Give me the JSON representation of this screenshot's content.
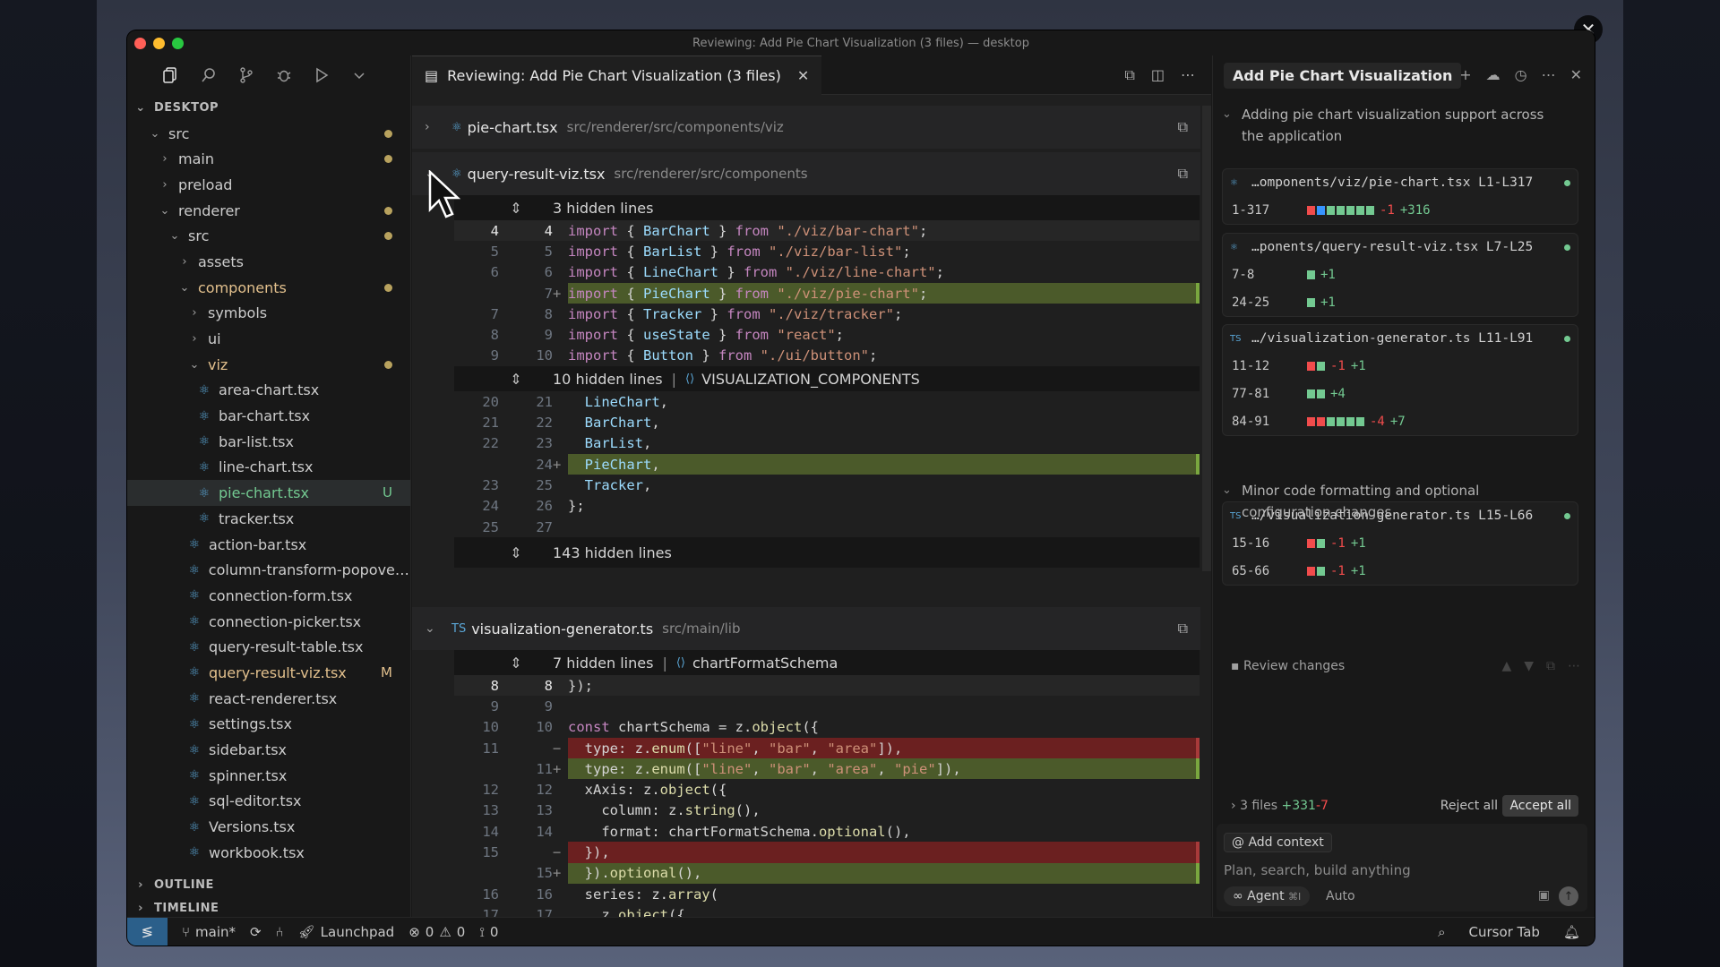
{
  "window": {
    "title": "Reviewing: Add Pie Chart Visualization (3 files) — desktop",
    "traffic_colors": [
      "#ff5f57",
      "#febc2e",
      "#28c840"
    ],
    "overlay_close_icon": "close-icon"
  },
  "activity_bar": {
    "icons": [
      "files-icon",
      "search-icon",
      "source-control-icon",
      "debug-icon",
      "run-icon",
      "chevron-down-icon"
    ]
  },
  "explorer": {
    "root": "DESKTOP",
    "items": [
      {
        "label": "src",
        "depth": 0,
        "kind": "folder-open",
        "status": "dot"
      },
      {
        "label": "main",
        "depth": 1,
        "kind": "folder",
        "status": "dot"
      },
      {
        "label": "preload",
        "depth": 1,
        "kind": "folder",
        "status": ""
      },
      {
        "label": "renderer",
        "depth": 1,
        "kind": "folder-open",
        "status": "dot"
      },
      {
        "label": "src",
        "depth": 2,
        "kind": "folder-open",
        "status": "dot"
      },
      {
        "label": "assets",
        "depth": 3,
        "kind": "folder",
        "status": ""
      },
      {
        "label": "components",
        "depth": 3,
        "kind": "folder-open",
        "status": "dot",
        "modified": true
      },
      {
        "label": "symbols",
        "depth": 4,
        "kind": "folder",
        "status": ""
      },
      {
        "label": "ui",
        "depth": 4,
        "kind": "folder",
        "status": ""
      },
      {
        "label": "viz",
        "depth": 4,
        "kind": "folder-open",
        "status": "dot",
        "modified": true
      },
      {
        "label": "area-chart.tsx",
        "depth": 5,
        "kind": "file",
        "status": ""
      },
      {
        "label": "bar-chart.tsx",
        "depth": 5,
        "kind": "file",
        "status": ""
      },
      {
        "label": "bar-list.tsx",
        "depth": 5,
        "kind": "file",
        "status": ""
      },
      {
        "label": "line-chart.tsx",
        "depth": 5,
        "kind": "file",
        "status": ""
      },
      {
        "label": "pie-chart.tsx",
        "depth": 5,
        "kind": "file",
        "status": "U",
        "selected": true
      },
      {
        "label": "tracker.tsx",
        "depth": 5,
        "kind": "file",
        "status": ""
      },
      {
        "label": "action-bar.tsx",
        "depth": 4,
        "kind": "file",
        "status": ""
      },
      {
        "label": "column-transform-popover...",
        "depth": 4,
        "kind": "file",
        "status": ""
      },
      {
        "label": "connection-form.tsx",
        "depth": 4,
        "kind": "file",
        "status": ""
      },
      {
        "label": "connection-picker.tsx",
        "depth": 4,
        "kind": "file",
        "status": ""
      },
      {
        "label": "query-result-table.tsx",
        "depth": 4,
        "kind": "file",
        "status": ""
      },
      {
        "label": "query-result-viz.tsx",
        "depth": 4,
        "kind": "file",
        "status": "M"
      },
      {
        "label": "react-renderer.tsx",
        "depth": 4,
        "kind": "file",
        "status": ""
      },
      {
        "label": "settings.tsx",
        "depth": 4,
        "kind": "file",
        "status": ""
      },
      {
        "label": "sidebar.tsx",
        "depth": 4,
        "kind": "file",
        "status": ""
      },
      {
        "label": "spinner.tsx",
        "depth": 4,
        "kind": "file",
        "status": ""
      },
      {
        "label": "sql-editor.tsx",
        "depth": 4,
        "kind": "file",
        "status": ""
      },
      {
        "label": "Versions.tsx",
        "depth": 4,
        "kind": "file",
        "status": ""
      },
      {
        "label": "workbook.tsx",
        "depth": 4,
        "kind": "file",
        "status": ""
      }
    ],
    "outline": "OUTLINE",
    "timeline": "TIMELINE"
  },
  "editor": {
    "tab_label": "Reviewing: Add Pie Chart Visualization (3 files)",
    "files": [
      {
        "type": "⚛",
        "name": "pie-chart.tsx",
        "path": "src/renderer/src/components/viz",
        "chevron": "›"
      },
      {
        "type": "⚛",
        "name": "query-result-viz.tsx",
        "path": "src/renderer/src/components",
        "chevron": "⌄"
      },
      {
        "type": "TS",
        "name": "visualization-generator.ts",
        "path": "src/main/lib",
        "chevron": "⌄"
      }
    ],
    "hidden": {
      "h1": "3 hidden lines",
      "h2": "10 hidden lines",
      "h2_symbol": "VISUALIZATION_COMPONENTS",
      "h3": "143 hidden lines",
      "h4": "7 hidden lines",
      "h4_symbol": "chartFormatSchema",
      "separator": "|"
    },
    "block1": [
      {
        "o": "4",
        "n": "4",
        "m": "",
        "kind": "cur",
        "code": "import { BarChart } from \"./viz/bar-chart\";"
      },
      {
        "o": "5",
        "n": "5",
        "m": "",
        "kind": "",
        "code": "import { BarList } from \"./viz/bar-list\";"
      },
      {
        "o": "6",
        "n": "6",
        "m": "",
        "kind": "",
        "code": "import { LineChart } from \"./viz/line-chart\";"
      },
      {
        "o": "",
        "n": "7",
        "m": "+",
        "kind": "add",
        "code": "import { PieChart } from \"./viz/pie-chart\";"
      },
      {
        "o": "7",
        "n": "8",
        "m": "",
        "kind": "",
        "code": "import { Tracker } from \"./viz/tracker\";"
      },
      {
        "o": "8",
        "n": "9",
        "m": "",
        "kind": "",
        "code": "import { useState } from \"react\";"
      },
      {
        "o": "9",
        "n": "10",
        "m": "",
        "kind": "",
        "code": "import { Button } from \"./ui/button\";"
      }
    ],
    "block2": [
      {
        "o": "20",
        "n": "21",
        "m": "",
        "kind": "",
        "code": "  LineChart,"
      },
      {
        "o": "21",
        "n": "22",
        "m": "",
        "kind": "",
        "code": "  BarChart,"
      },
      {
        "o": "22",
        "n": "23",
        "m": "",
        "kind": "",
        "code": "  BarList,"
      },
      {
        "o": "",
        "n": "24",
        "m": "+",
        "kind": "add",
        "code": "  PieChart,"
      },
      {
        "o": "23",
        "n": "25",
        "m": "",
        "kind": "",
        "code": "  Tracker,"
      },
      {
        "o": "24",
        "n": "26",
        "m": "",
        "kind": "",
        "code": "};"
      },
      {
        "o": "25",
        "n": "27",
        "m": "",
        "kind": "",
        "code": ""
      }
    ],
    "block3": [
      {
        "o": "8",
        "n": "8",
        "m": "",
        "kind": "cur",
        "code": "});"
      },
      {
        "o": "9",
        "n": "9",
        "m": "",
        "kind": "",
        "code": ""
      },
      {
        "o": "10",
        "n": "10",
        "m": "",
        "kind": "",
        "code": "const chartSchema = z.object({"
      },
      {
        "o": "11",
        "n": "",
        "m": "−",
        "kind": "del",
        "code": "  type: z.enum([\"line\", \"bar\", \"area\"]),"
      },
      {
        "o": "",
        "n": "11",
        "m": "+",
        "kind": "add",
        "code": "  type: z.enum([\"line\", \"bar\", \"area\", \"pie\"]),"
      },
      {
        "o": "12",
        "n": "12",
        "m": "",
        "kind": "",
        "code": "  xAxis: z.object({"
      },
      {
        "o": "13",
        "n": "13",
        "m": "",
        "kind": "",
        "code": "    column: z.string(),"
      },
      {
        "o": "14",
        "n": "14",
        "m": "",
        "kind": "",
        "code": "    format: chartFormatSchema.optional(),"
      },
      {
        "o": "15",
        "n": "",
        "m": "−",
        "kind": "del",
        "code": "  }),"
      },
      {
        "o": "",
        "n": "15",
        "m": "+",
        "kind": "add",
        "code": "  }).optional(),"
      },
      {
        "o": "16",
        "n": "16",
        "m": "",
        "kind": "",
        "code": "  series: z.array("
      },
      {
        "o": "17",
        "n": "17",
        "m": "",
        "kind": "",
        "code": "    z.object({"
      },
      {
        "o": "18",
        "n": "18",
        "m": "",
        "kind": "",
        "code": "      column: z.string(),"
      }
    ]
  },
  "chat": {
    "tab_title": "Add Pie Chart Visualization",
    "header_icons": [
      "plus-icon",
      "cloud-icon",
      "history-icon",
      "more-icon",
      "close-icon"
    ],
    "note1": "Adding pie chart visualization support across the application",
    "note2": "Minor code formatting and optional configuration changes",
    "cards": [
      {
        "type": "⚛",
        "file": "…omponents/viz/pie-chart.tsx L1-L317",
        "rows": [
          {
            "range": "1-317",
            "blocks": [
              "r",
              "b",
              "g",
              "g",
              "g",
              "g",
              "g"
            ],
            "del": "-1",
            "add": "+316"
          }
        ]
      },
      {
        "type": "⚛",
        "file": "…ponents/query-result-viz.tsx L7-L25",
        "rows": [
          {
            "range": "7-8",
            "blocks": [
              "g"
            ],
            "del": "",
            "add": "+1"
          },
          {
            "range": "24-25",
            "blocks": [
              "g"
            ],
            "del": "",
            "add": "+1"
          }
        ]
      },
      {
        "type": "TS",
        "file": "…/visualization-generator.ts L11-L91",
        "rows": [
          {
            "range": "11-12",
            "blocks": [
              "r",
              "g"
            ],
            "del": "-1",
            "add": "+1"
          },
          {
            "range": "77-81",
            "blocks": [
              "g",
              "g"
            ],
            "del": "",
            "add": "+4"
          },
          {
            "range": "84-91",
            "blocks": [
              "r",
              "r",
              "g",
              "g",
              "g",
              "g"
            ],
            "del": "-4",
            "add": "+7"
          }
        ]
      },
      {
        "type": "TS",
        "file": "…/visualization-generator.ts L15-L66",
        "rows": [
          {
            "range": "15-16",
            "blocks": [
              "r",
              "g"
            ],
            "del": "-1",
            "add": "+1"
          },
          {
            "range": "65-66",
            "blocks": [
              "r",
              "g"
            ],
            "del": "-1",
            "add": "+1"
          }
        ]
      }
    ],
    "review_label": "Review changes",
    "summary_files": "3 files",
    "summary_add": "+331",
    "summary_del": "-7",
    "reject_all": "Reject all",
    "accept_all": "Accept all",
    "add_context": "Add context",
    "input_placeholder": "Plan, search, build anything",
    "agent_label": "Agent",
    "agent_shortcut": "⌘I",
    "model_label": "Auto"
  },
  "statusbar": {
    "branch": "main*",
    "launchpad": "Launchpad",
    "errors": "0",
    "warnings": "0",
    "ports": "0",
    "cursor_tab": "Cursor Tab"
  },
  "colors": {
    "added_bg": "#4b5a2a",
    "removed_bg": "#6b2020",
    "accent": "#2b5f8a",
    "modified": "#e2c08d",
    "untracked": "#73c991"
  }
}
